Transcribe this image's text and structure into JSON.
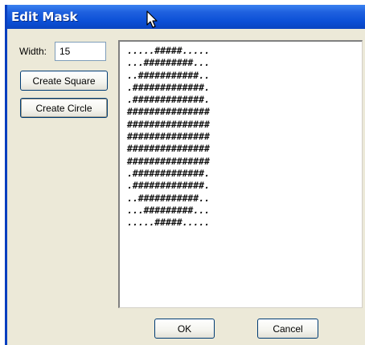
{
  "window": {
    "title": "Edit Mask"
  },
  "controls": {
    "width_label": "Width:",
    "width_value": "15",
    "create_square_label": "Create Square",
    "create_circle_label": "Create Circle"
  },
  "mask": {
    "text": ".....#####.....\n...#########...\n..###########..\n.#############.\n.#############.\n###############\n###############\n###############\n###############\n###############\n.#############.\n.#############.\n..###########..\n...#########...\n.....#####....."
  },
  "footer": {
    "ok_label": "OK",
    "cancel_label": "Cancel"
  },
  "colors": {
    "titlebar": "#0b4fd6",
    "dialog_bg": "#ece9d8",
    "button_border": "#003c74"
  },
  "icons": {
    "cursor": "mouse-pointer-icon"
  }
}
